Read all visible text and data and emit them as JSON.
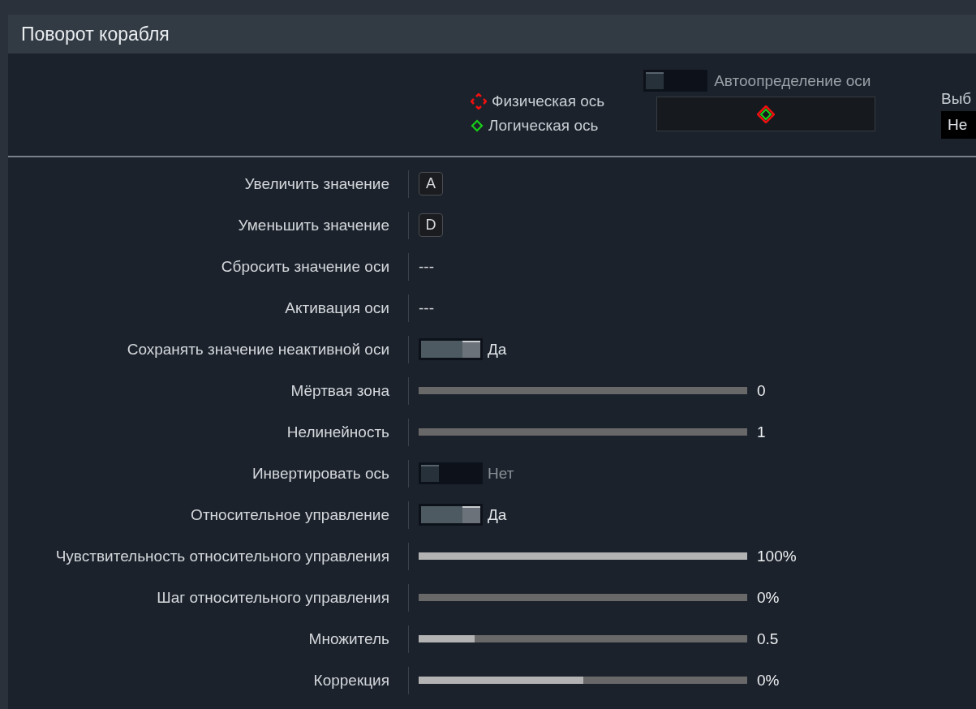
{
  "window": {
    "title": "Поворот корабля"
  },
  "legend": [
    {
      "kind": "physical",
      "label": "Физическая ось"
    },
    {
      "kind": "logical",
      "label": "Логическая ось"
    }
  ],
  "auto_detect": {
    "on": false,
    "label": "Автоопределение оси"
  },
  "device_select": {
    "label": "Выб",
    "value": "Не"
  },
  "rows": [
    {
      "kind": "binding",
      "label": "Увеличить значение",
      "key": "A"
    },
    {
      "kind": "binding",
      "label": "Уменьшить значение",
      "key": "D"
    },
    {
      "kind": "binding",
      "label": "Сбросить значение оси",
      "value": "---"
    },
    {
      "kind": "binding",
      "label": "Активация оси",
      "value": "---"
    },
    {
      "kind": "toggle",
      "label": "Сохранять значение неактивной оси",
      "on": true,
      "value": "Да"
    },
    {
      "kind": "slider",
      "label": "Мёртвая зона",
      "level": 0,
      "reading": "0"
    },
    {
      "kind": "slider",
      "label": "Нелинейность",
      "level": 0,
      "reading": "1"
    },
    {
      "kind": "toggle",
      "label": "Инвертировать ось",
      "on": false,
      "value": "Нет"
    },
    {
      "kind": "toggle",
      "label": "Относительное управление",
      "on": true,
      "value": "Да"
    },
    {
      "kind": "slider",
      "label": "Чувствительность относительного управления",
      "level": 1,
      "reading": "100%"
    },
    {
      "kind": "slider",
      "label": "Шаг относительного управления",
      "level": 0,
      "reading": "0%"
    },
    {
      "kind": "slider",
      "label": "Множитель",
      "level": 0.17,
      "reading": "0.5"
    },
    {
      "kind": "slider",
      "label": "Коррекция",
      "level": 0.5,
      "reading": "0%"
    }
  ]
}
